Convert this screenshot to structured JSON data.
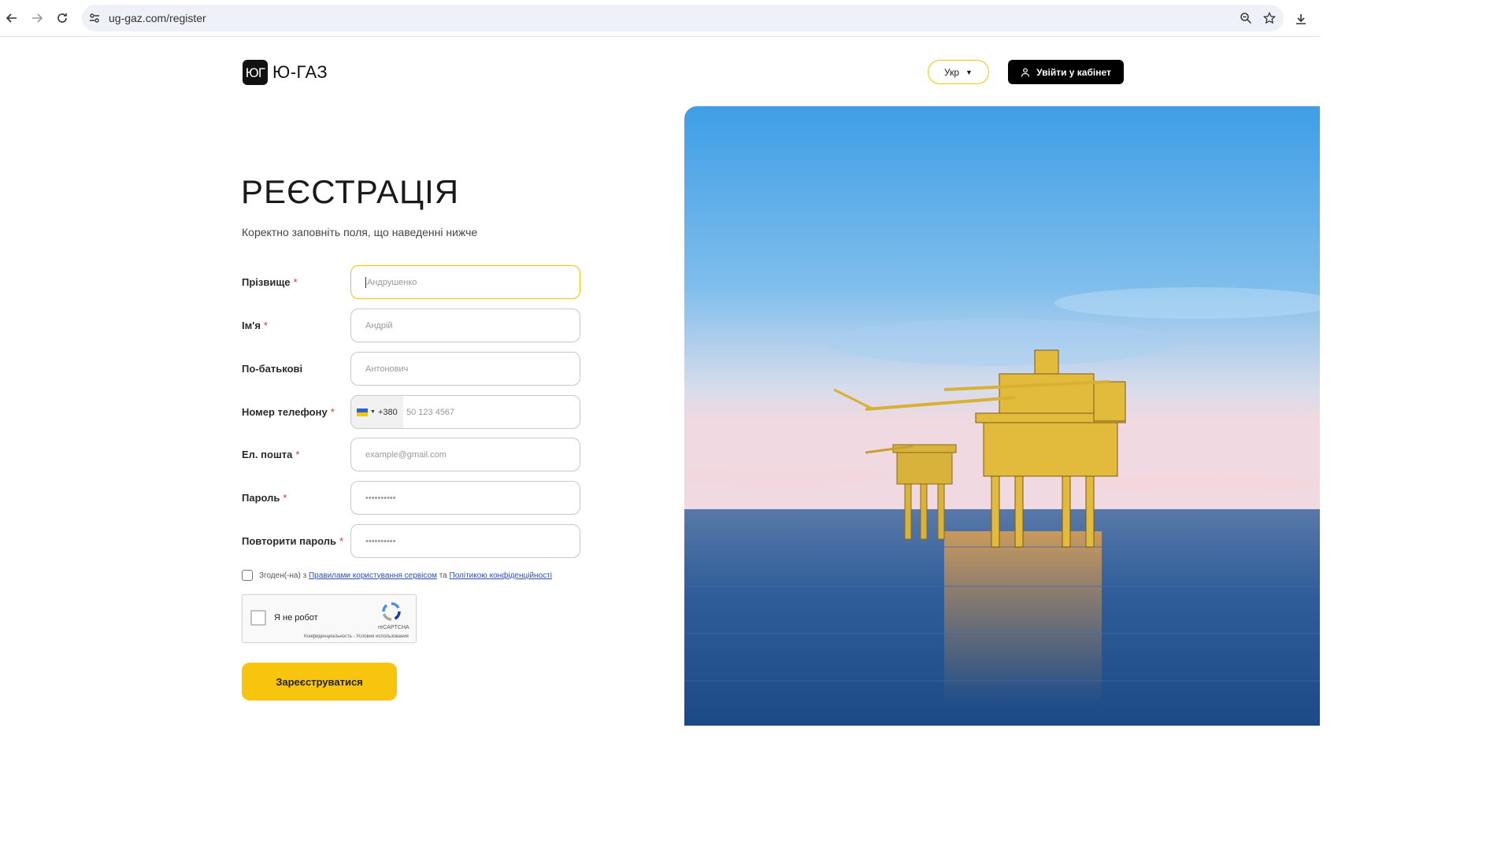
{
  "browser": {
    "url": "ug-gaz.com/register"
  },
  "header": {
    "logo_mark": "ЮГ",
    "logo_text": "Ю-ГАЗ",
    "language": "Укр",
    "login_label": "Увійти у кабінет"
  },
  "form": {
    "title": "РЕЄСТРАЦІЯ",
    "subtitle": "Коректно заповніть поля, що наведенні нижче",
    "fields": [
      {
        "label": "Прізвище",
        "required": "*",
        "placeholder": "Андрушенко"
      },
      {
        "label": "Ім'я",
        "required": "*",
        "placeholder": "Андрій"
      },
      {
        "label": "По-батькові",
        "required": "",
        "placeholder": "Антонович"
      },
      {
        "label": "Номер телефону",
        "required": "*",
        "country_code": "+380",
        "placeholder": "50 123 4567"
      },
      {
        "label": "Ел. пошта",
        "required": "*",
        "placeholder": "example@gmail.com"
      },
      {
        "label": "Пароль",
        "required": "*",
        "placeholder": "••••••••••"
      },
      {
        "label": "Повторити пароль",
        "required": "*",
        "placeholder": "••••••••••"
      }
    ],
    "consent": {
      "prefix": "Згоден(-на) з",
      "link1": "Правилами користування сервісом",
      "middle": "та",
      "link2": "Політикою конфіденційності"
    },
    "captcha": {
      "label": "Я не робот",
      "brand": "reCAPTCHA",
      "links": "Конфиденциальность - Условия использования"
    },
    "submit_label": "Зареєструватися"
  },
  "colors": {
    "accent": "#f7c50d",
    "dark": "#000000",
    "required": "#d03a2a"
  }
}
